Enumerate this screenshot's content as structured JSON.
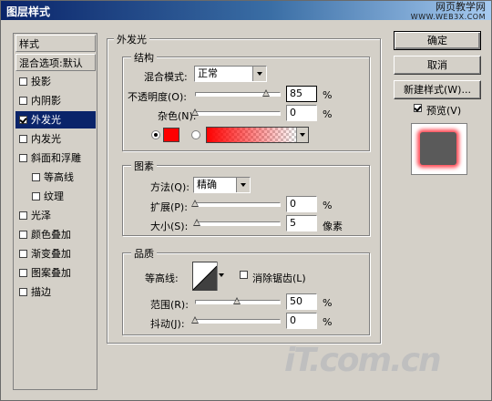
{
  "window": {
    "title": "图层样式",
    "watermark_line1": "网页教学网",
    "watermark_line2": "WWW.WEB3X.COM"
  },
  "sidebar": {
    "header": "样式",
    "items": [
      {
        "label": "混合选项:默认",
        "checkbox": false,
        "header": true
      },
      {
        "label": "投影",
        "checked": false
      },
      {
        "label": "内阴影",
        "checked": false
      },
      {
        "label": "外发光",
        "checked": true,
        "selected": true
      },
      {
        "label": "内发光",
        "checked": false
      },
      {
        "label": "斜面和浮雕",
        "checked": false
      },
      {
        "label": "等高线",
        "checked": false,
        "sub": true
      },
      {
        "label": "纹理",
        "checked": false,
        "sub": true
      },
      {
        "label": "光泽",
        "checked": false
      },
      {
        "label": "颜色叠加",
        "checked": false
      },
      {
        "label": "渐变叠加",
        "checked": false
      },
      {
        "label": "图案叠加",
        "checked": false
      },
      {
        "label": "描边",
        "checked": false
      }
    ]
  },
  "panel": {
    "title": "外发光",
    "structure": {
      "label": "结构",
      "blend_mode_label": "混合模式:",
      "blend_mode_value": "正常",
      "opacity_label": "不透明度(O):",
      "opacity_value": "85",
      "opacity_unit": "%",
      "opacity_level": 0.85,
      "noise_label": "杂色(N):",
      "noise_value": "0",
      "noise_unit": "%",
      "noise_level": 0,
      "glow_color": "#ff0000"
    },
    "elements": {
      "label": "图素",
      "method_label": "方法(Q):",
      "method_value": "精确",
      "spread_label": "扩展(P):",
      "spread_value": "0",
      "spread_unit": "%",
      "spread_level": 0,
      "size_label": "大小(S):",
      "size_value": "5",
      "size_unit": "像素",
      "size_level": 0.02
    },
    "quality": {
      "label": "品质",
      "contour_label": "等高线:",
      "antialias_label": "消除锯齿(L)",
      "range_label": "范围(R):",
      "range_value": "50",
      "range_unit": "%",
      "range_level": 0.5,
      "jitter_label": "抖动(J):",
      "jitter_value": "0",
      "jitter_unit": "%",
      "jitter_level": 0
    }
  },
  "buttons": {
    "ok": "确定",
    "cancel": "取消",
    "new_style": "新建样式(W)...",
    "preview": "预览(V)"
  },
  "preview": {
    "glow_color": "#ff4a55",
    "fill_color": "#5a5a5a"
  },
  "footer_logo": "iT.com.cn"
}
